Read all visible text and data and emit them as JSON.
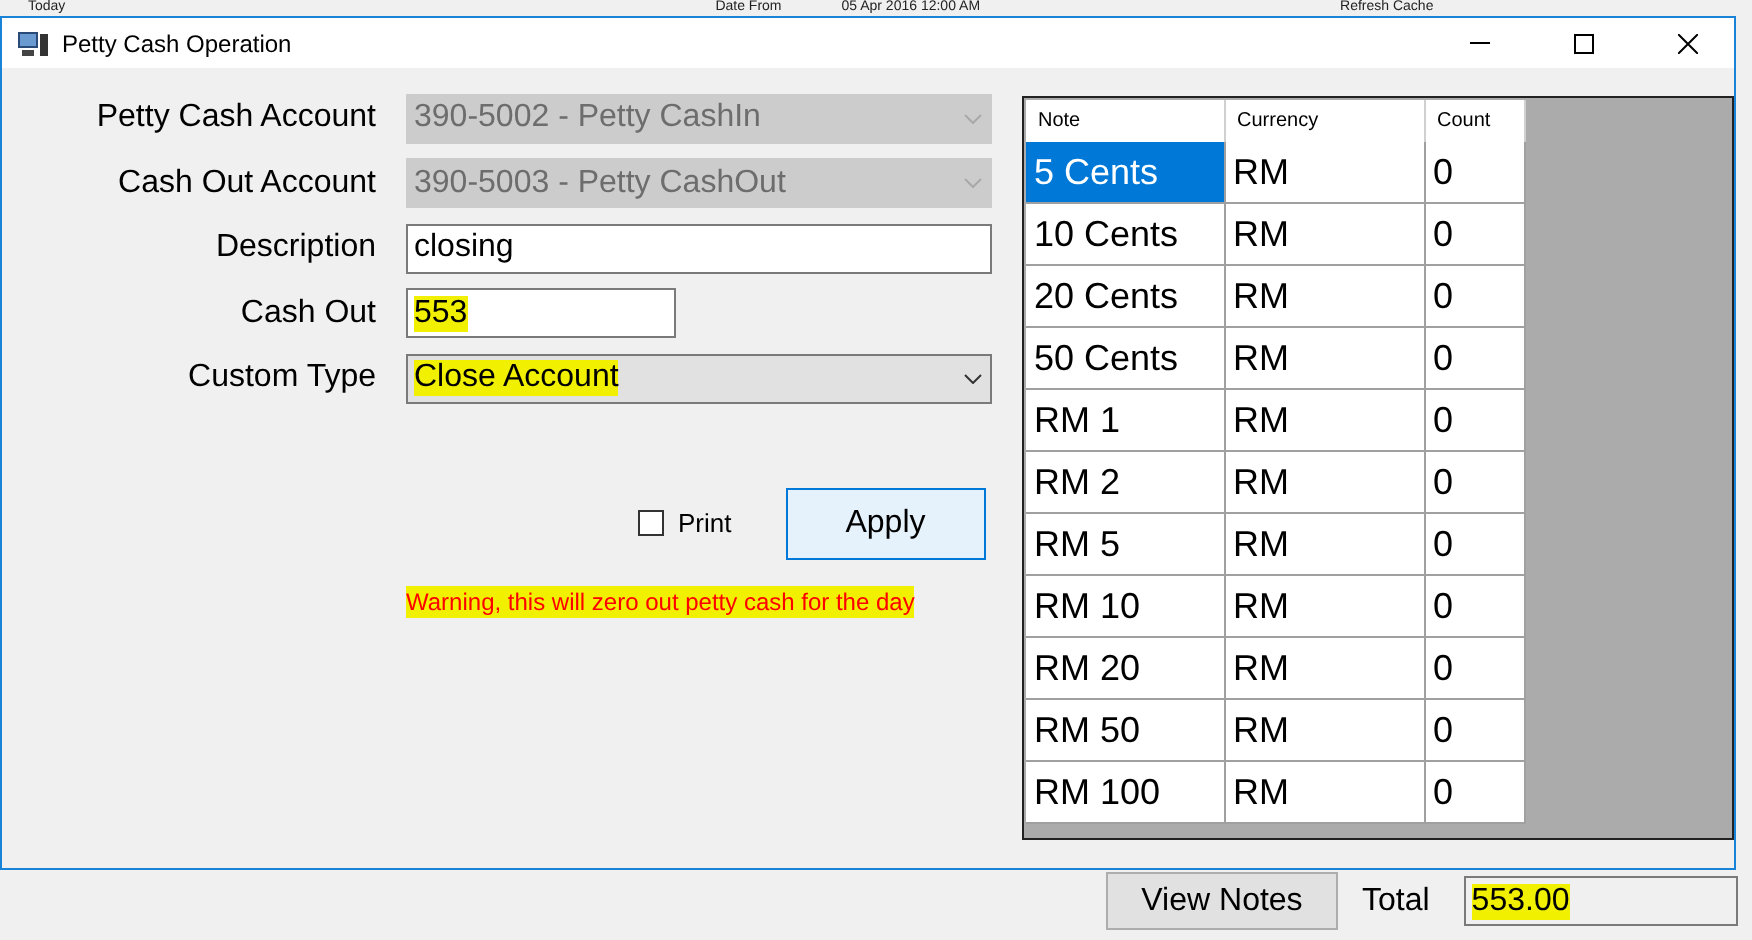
{
  "background_toolbar": {
    "period": "Today",
    "date_label": "Date From",
    "date_value": "05 Apr 2016 12:00 AM",
    "refresh_button": "Refresh Cache"
  },
  "window": {
    "title": "Petty Cash Operation"
  },
  "form": [
    {
      "kind": "combo",
      "label": "Petty Cash Account",
      "value": "390-5002 - Petty CashIn",
      "disabled": true,
      "highlighted": false
    },
    {
      "kind": "combo",
      "label": "Cash Out Account",
      "value": "390-5003 - Petty CashOut",
      "disabled": true,
      "highlighted": false
    },
    {
      "kind": "text",
      "label": "Description",
      "value": "closing",
      "disabled": false,
      "highlighted": false
    },
    {
      "kind": "short",
      "label": "Cash Out",
      "value": "553",
      "disabled": false,
      "highlighted": true
    },
    {
      "kind": "combo",
      "label": "Custom Type",
      "value": "Close Account",
      "disabled": false,
      "highlighted": true
    }
  ],
  "print": {
    "label": "Print",
    "checked": false
  },
  "apply_button": "Apply",
  "warning": {
    "text": "Warning, this will zero out petty cash for the day",
    "highlighted": true
  },
  "table": {
    "columns": [
      "Note",
      "Currency",
      "Count"
    ],
    "rows": [
      {
        "cells": [
          "5 Cents",
          "RM",
          "0"
        ],
        "selected": true
      },
      {
        "cells": [
          "10 Cents",
          "RM",
          "0"
        ],
        "selected": false
      },
      {
        "cells": [
          "20 Cents",
          "RM",
          "0"
        ],
        "selected": false
      },
      {
        "cells": [
          "50 Cents",
          "RM",
          "0"
        ],
        "selected": false
      },
      {
        "cells": [
          "RM 1",
          "RM",
          "0"
        ],
        "selected": false
      },
      {
        "cells": [
          "RM 2",
          "RM",
          "0"
        ],
        "selected": false
      },
      {
        "cells": [
          "RM 5",
          "RM",
          "0"
        ],
        "selected": false
      },
      {
        "cells": [
          "RM 10",
          "RM",
          "0"
        ],
        "selected": false
      },
      {
        "cells": [
          "RM 20",
          "RM",
          "0"
        ],
        "selected": false
      },
      {
        "cells": [
          "RM 50",
          "RM",
          "0"
        ],
        "selected": false
      },
      {
        "cells": [
          "RM 100",
          "RM",
          "0"
        ],
        "selected": false
      }
    ]
  },
  "footer": {
    "view_notes_button": "View Notes",
    "total_label": "Total",
    "total_value": "553.00",
    "total_highlighted": true
  }
}
